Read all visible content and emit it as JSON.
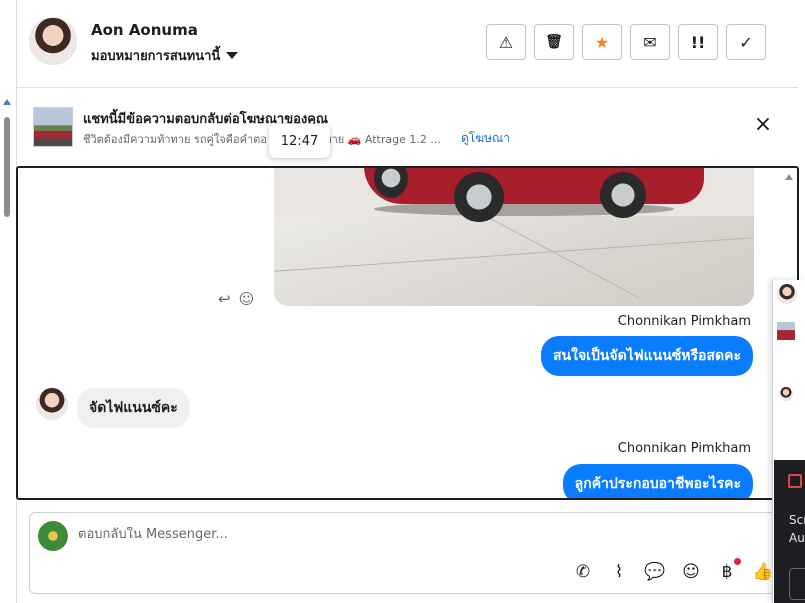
{
  "header": {
    "contact_name": "Aon Aonuma",
    "assign_label": "มอบหมายการสนทนานี้",
    "actions": [
      {
        "name": "spam",
        "glyph": "⚠"
      },
      {
        "name": "delete",
        "glyph": "🗑"
      },
      {
        "name": "star",
        "glyph": "★"
      },
      {
        "name": "mark-unread",
        "glyph": "✉"
      },
      {
        "name": "follow-up",
        "glyph": "!!"
      },
      {
        "name": "done",
        "glyph": "✓"
      }
    ]
  },
  "banner": {
    "title": "แชทนี้มีข้อความตอบกลับต่อโฆษณาของคุณ",
    "subtitle": "ชีวิตต้องมีความท้าทาย รถคู่ใจคือคำตอ",
    "subtitle_tail": "ท้าทาย 🚗 Attrage 1.2 ...",
    "link": "ดูโฆษณา",
    "tooltip_time": "12:47"
  },
  "messages": [
    {
      "sender": "Chonnikan Pimkham",
      "text": "สนใจเป็นจัดไฟแนนซ์หรือสดคะ"
    },
    {
      "text": "จัดไฟแนนซ์คะ"
    },
    {
      "sender": "Chonnikan Pimkham",
      "text": "ลูกค้าประกอบอาชีพอะไรคะ"
    }
  ],
  "composer": {
    "placeholder": "ตอบกลับใน Messenger..."
  },
  "side_panel": {
    "line1": "Scr",
    "line2": "Au"
  }
}
